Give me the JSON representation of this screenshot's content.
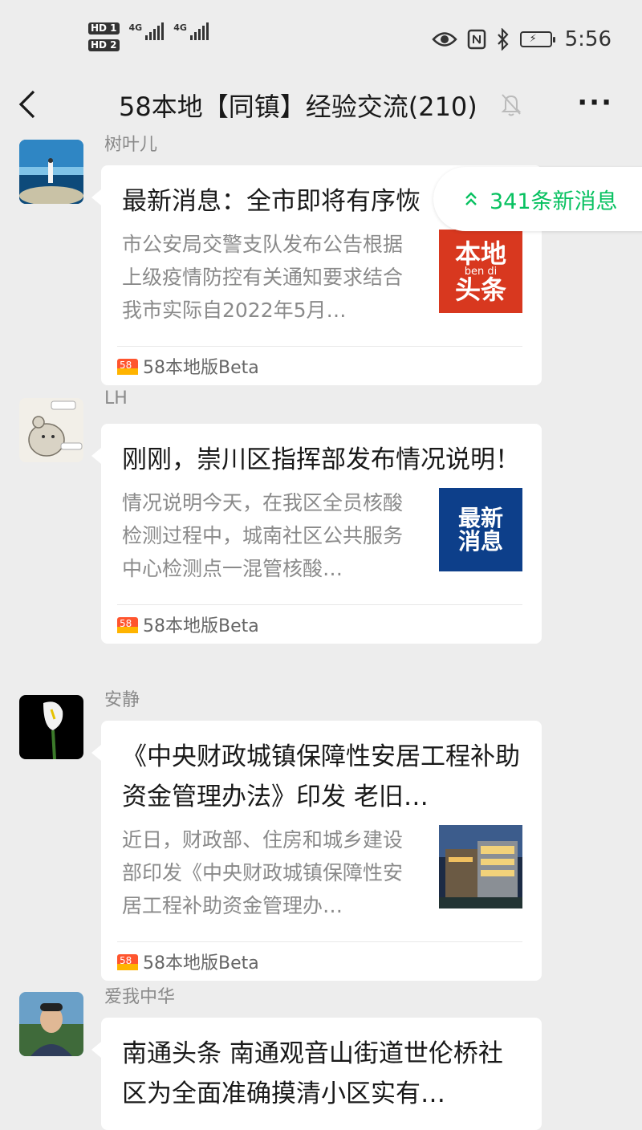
{
  "status_bar": {
    "hd1": "HD 1",
    "hd2": "HD 2",
    "net1": "4G",
    "net2": "4G",
    "time": "5:56"
  },
  "nav": {
    "title": "58本地【同镇】经验交流(210)",
    "more": "···"
  },
  "new_messages": {
    "label": "341条新消息"
  },
  "messages": [
    {
      "sender": "树叶儿",
      "title": "最新消息：全市即将有序恢",
      "description": "市公安局交警支队发布公告根据上级疫情防控有关通知要求结合我市实际自2022年5月…",
      "thumb_text": [
        "本地",
        "ben di",
        "头条"
      ],
      "source": "58本地版Beta"
    },
    {
      "sender": "LH",
      "title": "刚刚，崇川区指挥部发布情况说明！",
      "description": "情况说明今天，在我区全员核酸检测过程中，城南社区公共服务中心检测点一混管核酸…",
      "thumb_text": [
        "最新",
        "消息"
      ],
      "source": "58本地版Beta"
    },
    {
      "sender": "安静",
      "title": "《中央财政城镇保障性安居工程补助资金管理办法》印发 老旧…",
      "description": "近日，财政部、住房和城乡建设部印发《中央财政城镇保障性安居工程补助资金管理办…",
      "source": "58本地版Beta"
    },
    {
      "sender": "爱我中华",
      "title": "南通头条 南通观音山街道世伦桥社区为全面准确摸清小区实有…"
    }
  ],
  "colors": {
    "accent_green": "#07c160",
    "background": "#ededed",
    "local_red": "#d8381f",
    "news_blue": "#0d3f8a"
  }
}
